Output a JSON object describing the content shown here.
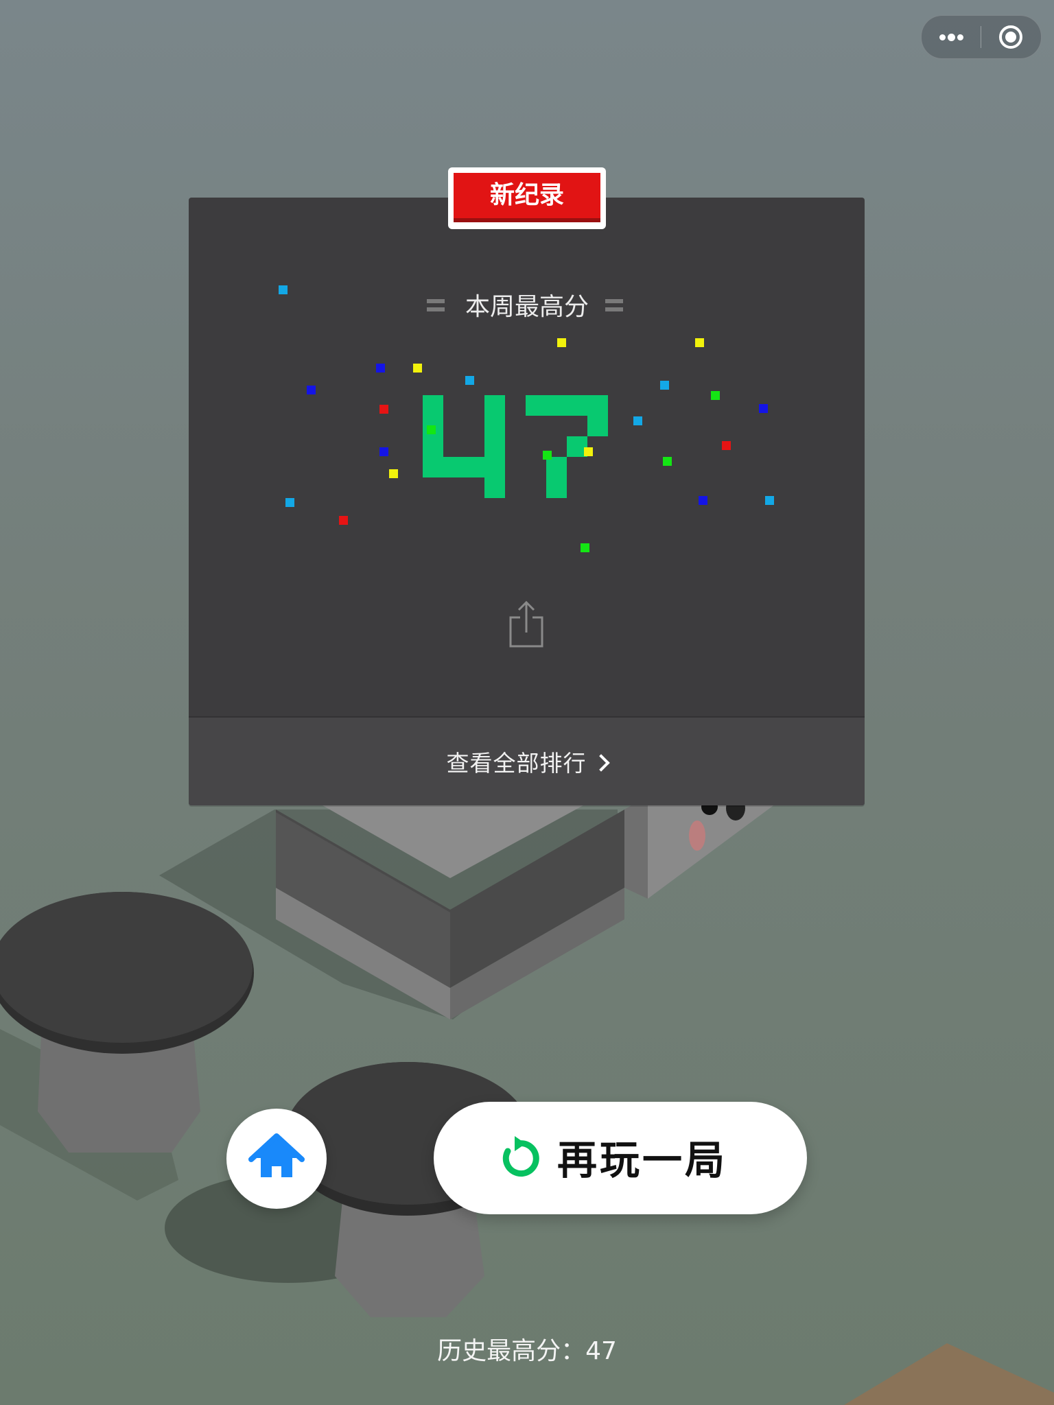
{
  "badge": {
    "label": "新纪录"
  },
  "week": {
    "title": "本周最高分",
    "score": "47"
  },
  "footer": {
    "label": "查看全部排行"
  },
  "actions": {
    "replay_label": "再玩一局"
  },
  "history": {
    "label": "历史最高分：47"
  },
  "icons": {
    "more": "more-icon",
    "close": "capsule-close-icon",
    "share": "share-icon",
    "home": "home-icon",
    "replay": "replay-icon",
    "chevron": "chevron-right-icon"
  },
  "colors": {
    "score_green": "#08c970",
    "badge_red": "#e11414",
    "home_blue": "#1989fa",
    "replay_green": "#07c160",
    "panel": "#3d3c3e"
  }
}
